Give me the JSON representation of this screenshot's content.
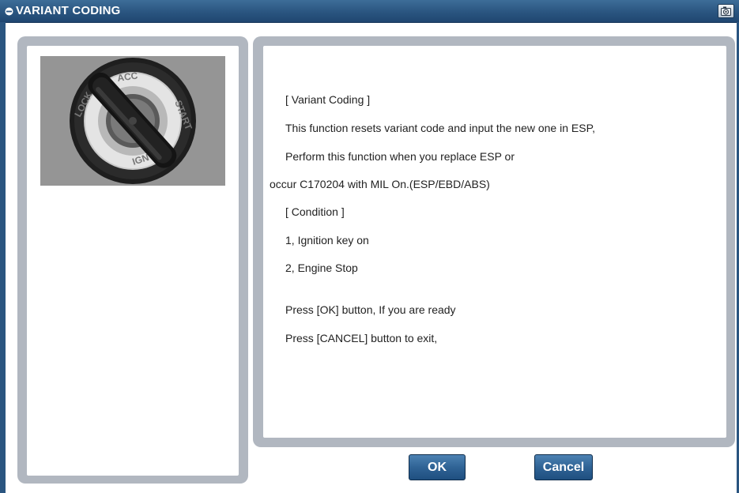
{
  "window": {
    "title": "VARIANT CODING",
    "title_icon": "shield-icon",
    "capture_icon": "camera-icon"
  },
  "image": {
    "alt": "ignition key switch",
    "dial_labels": [
      "LOCK",
      "ACC",
      "START",
      "IGN"
    ]
  },
  "info": {
    "lines": [
      "[ Variant Coding ]",
      "This function resets variant code and input the new one in ESP,",
      "Perform this function when you replace ESP or",
      "occur C170204 with MIL On.(ESP/EBD/ABS)",
      "[ Condition ]",
      "1, Ignition key on",
      "2, Engine Stop",
      "Press [OK] button, If you are ready",
      "Press [CANCEL] button to exit,"
    ]
  },
  "buttons": {
    "ok_label": "OK",
    "cancel_label": "Cancel"
  },
  "colors": {
    "titlebar": "#2a5580",
    "panel_border": "#b1b7c0",
    "button": "#2f6395"
  }
}
